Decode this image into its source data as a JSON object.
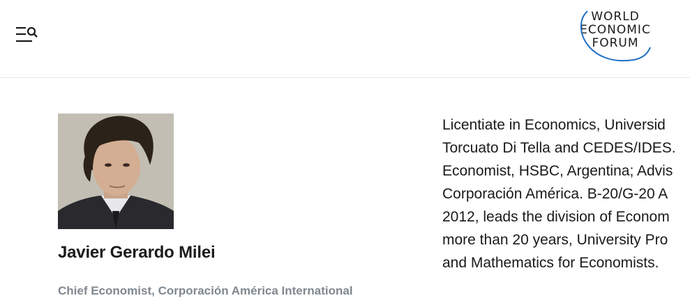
{
  "header": {
    "menu_icon": "menu-search-icon",
    "logo_lines": [
      "WORLD",
      "ECONOMIC",
      "FORUM"
    ],
    "logo_color": "#1a1a1a",
    "logo_accent_color": "#1f6fc4"
  },
  "profile": {
    "name": "Javier Gerardo Milei",
    "role": "Chief Economist, Corporación América International",
    "role_color": "#7f8890",
    "bio_lines": [
      "Licentiate in Economics, Universid",
      "Torcuato Di Tella and CEDES/IDES.",
      "Economist, HSBC, Argentina; Advis",
      "Corporación América. B-20/G-20 A",
      "2012, leads the division of Econom",
      "more than 20 years, University Pro",
      "and Mathematics for Economists."
    ]
  }
}
